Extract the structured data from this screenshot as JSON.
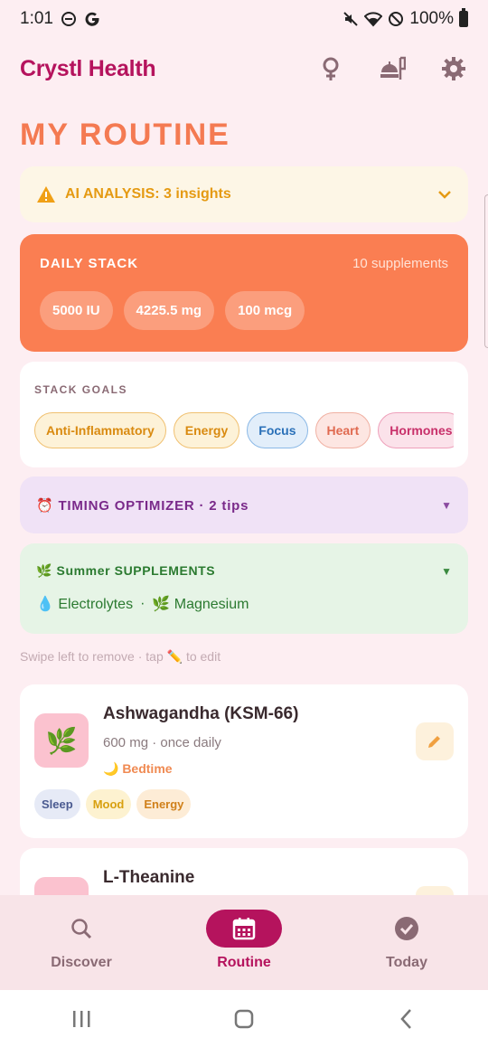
{
  "status": {
    "time": "1:01",
    "battery": "100%"
  },
  "app": {
    "brand": "Crystl Health"
  },
  "page": {
    "title": "MY ROUTINE"
  },
  "ai": {
    "label": "AI ANALYSIS: 3 insights"
  },
  "stack": {
    "title": "DAILY STACK",
    "count": "10 supplements",
    "pills": [
      "5000 IU",
      "4225.5 mg",
      "100 mcg"
    ]
  },
  "goals": {
    "title": "STACK GOALS",
    "chips": [
      "Anti-Inflammatory",
      "Energy",
      "Focus",
      "Heart",
      "Hormones"
    ]
  },
  "timing": {
    "label": "⏰ TIMING OPTIMIZER · 2 tips"
  },
  "summer": {
    "title": "🌿 Summer SUPPLEMENTS",
    "item1": "💧 Electrolytes",
    "sep": "·",
    "item2": "🌿 Magnesium"
  },
  "hint": "Swipe left to remove · tap ✏️ to edit",
  "supplements": [
    {
      "name": "Ashwagandha (KSM-66)",
      "dose": "600 mg · once daily",
      "time": "🌙 Bedtime",
      "tags": [
        "Sleep",
        "Mood",
        "Energy"
      ]
    },
    {
      "name": "L-Theanine"
    }
  ],
  "nav": {
    "discover": "Discover",
    "routine": "Routine",
    "today": "Today"
  },
  "colors": {
    "brand": "#b5135d",
    "accent": "#f47a52",
    "stack_bg": "#fa7e52"
  }
}
